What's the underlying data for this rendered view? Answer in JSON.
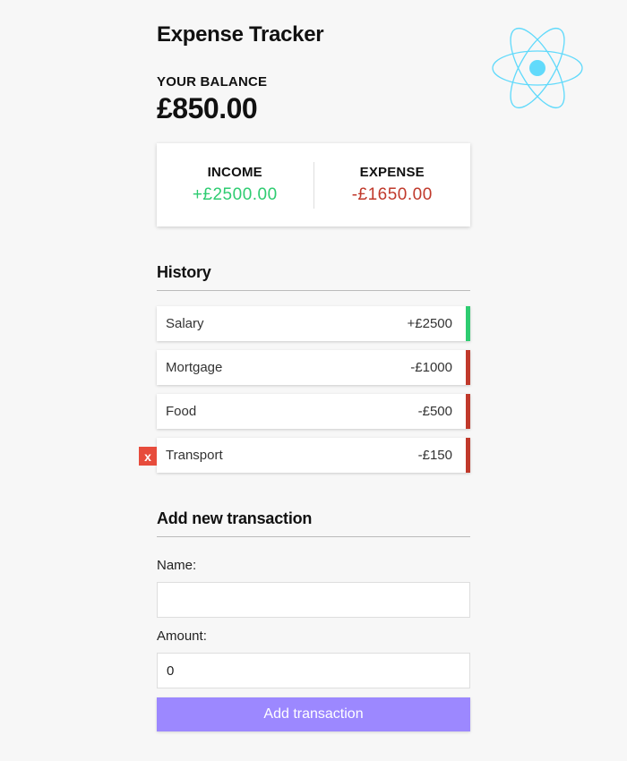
{
  "app": {
    "title": "Expense Tracker"
  },
  "balance": {
    "label": "YOUR BALANCE",
    "value": "£850.00"
  },
  "summary": {
    "income_label": "INCOME",
    "income_value": "+£2500.00",
    "expense_label": "EXPENSE",
    "expense_value": "-£1650.00"
  },
  "history": {
    "heading": "History",
    "items": [
      {
        "name": "Salary",
        "amount": "+£2500",
        "type": "income"
      },
      {
        "name": "Mortgage",
        "amount": "-£1000",
        "type": "expense"
      },
      {
        "name": "Food",
        "amount": "-£500",
        "type": "expense"
      },
      {
        "name": "Transport",
        "amount": "-£150",
        "type": "expense",
        "delete_label": "x"
      }
    ]
  },
  "form": {
    "heading": "Add new transaction",
    "name_label": "Name:",
    "name_value": "",
    "amount_label": "Amount:",
    "amount_value": "0",
    "submit_label": "Add transaction"
  },
  "colors": {
    "income": "#2ecc71",
    "expense": "#c0392b",
    "delete": "#e74c3c",
    "button": "#9c88ff",
    "logo": "#61dafb"
  },
  "icons": {
    "logo": "react-logo-icon"
  }
}
